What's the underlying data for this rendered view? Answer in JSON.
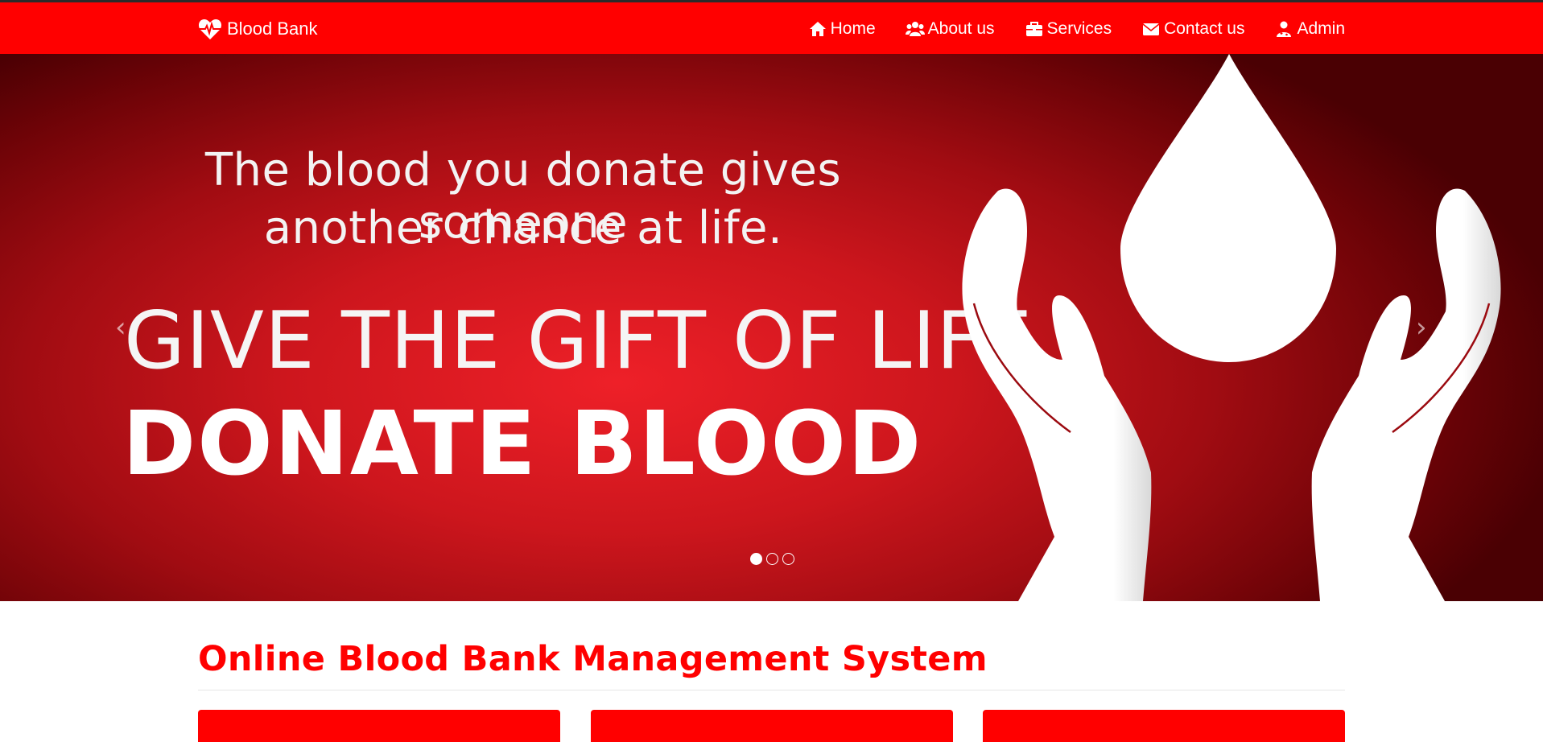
{
  "brand": {
    "label": "Blood Bank",
    "icon": "heartbeat-icon"
  },
  "nav": {
    "items": [
      {
        "label": "Home",
        "icon": "home-icon"
      },
      {
        "label": "About us",
        "icon": "users-icon"
      },
      {
        "label": "Services",
        "icon": "briefcase-icon"
      },
      {
        "label": "Contact us",
        "icon": "envelope-icon"
      },
      {
        "label": "Admin",
        "icon": "user-md-icon"
      }
    ]
  },
  "carousel": {
    "slide": {
      "line1": "The blood you donate gives someone",
      "line2": "another chance at life.",
      "headline": "GIVE THE GIFT OF LIFE",
      "subheadline": "DONATE BLOOD"
    },
    "prev_label": "‹",
    "next_label": "›",
    "indicator_count": 3,
    "active_index": 0
  },
  "main": {
    "title": "Online Blood Bank Management System"
  },
  "colors": {
    "brand_red": "#ff0000",
    "banner_red": "#cd161d",
    "text_white": "#ffffff"
  }
}
